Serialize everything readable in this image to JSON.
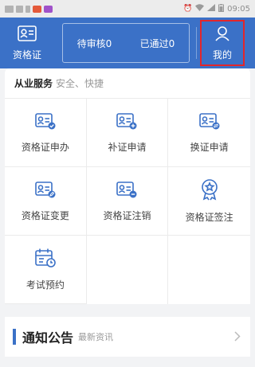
{
  "status_bar": {
    "time": "09:05"
  },
  "header": {
    "left_label": "资格证",
    "pending_label": "待审核0",
    "approved_label": "已通过0",
    "mine_label": "我的"
  },
  "services": {
    "title": "从业服务",
    "subtitle": "安全、快捷",
    "items": [
      {
        "label": "资格证申办",
        "icon": "id-card-apply-icon"
      },
      {
        "label": "补证申请",
        "icon": "id-card-reissue-icon"
      },
      {
        "label": "换证申请",
        "icon": "id-card-replace-icon"
      },
      {
        "label": "资格证变更",
        "icon": "id-card-change-icon"
      },
      {
        "label": "资格证注销",
        "icon": "id-card-cancel-icon"
      },
      {
        "label": "资格证签注",
        "icon": "badge-endorse-icon"
      },
      {
        "label": "考试预约",
        "icon": "calendar-clock-icon"
      }
    ]
  },
  "notice": {
    "title": "通知公告",
    "subtitle": "最新资讯"
  },
  "colors": {
    "primary": "#3b71c7",
    "highlight": "#e3262b"
  }
}
